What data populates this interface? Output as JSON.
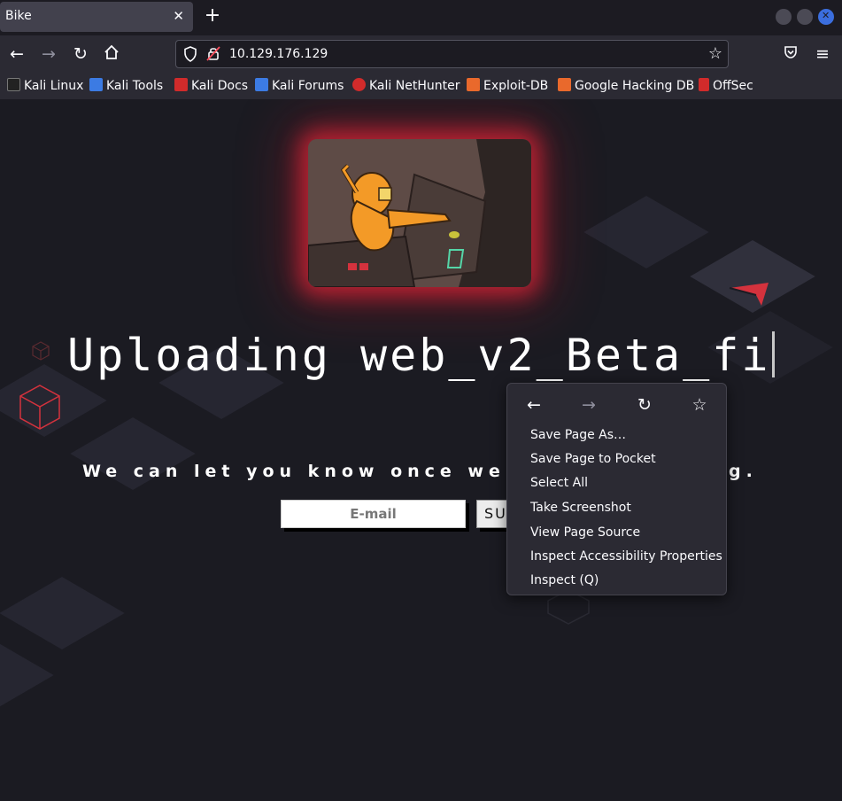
{
  "tab": {
    "title": "Bike",
    "close": "✕"
  },
  "newtab": "+",
  "navbar": {
    "url": "10.129.176.129"
  },
  "bookmarks": [
    {
      "label": "Kali Linux",
      "color": "#111111"
    },
    {
      "label": "Kali Tools",
      "color": "#3c7be3"
    },
    {
      "label": "Kali Docs",
      "color": "#d12b2b"
    },
    {
      "label": "Kali Forums",
      "color": "#3c7be3"
    },
    {
      "label": "Kali NetHunter",
      "color": "#d12b2b"
    },
    {
      "label": "Exploit-DB",
      "color": "#e9692c"
    },
    {
      "label": "Google Hacking DB",
      "color": "#e9692c"
    },
    {
      "label": "OffSec",
      "color": "#d12b2b"
    }
  ],
  "page": {
    "heading": "Uploading web_v2_Beta_fi",
    "subline": "We can let you know once we ar",
    "subline_end": "g.",
    "email_placeholder": "E-mail",
    "submit_label": "SU"
  },
  "context_menu": {
    "items": [
      "Save Page As…",
      "Save Page to Pocket",
      "Select All",
      "Take Screenshot",
      "View Page Source",
      "Inspect Accessibility Properties",
      "Inspect (Q)"
    ]
  },
  "colors": {
    "accent": "#3b6ede",
    "glow": "#ff2a40",
    "page_bg": "#1b1b22"
  }
}
